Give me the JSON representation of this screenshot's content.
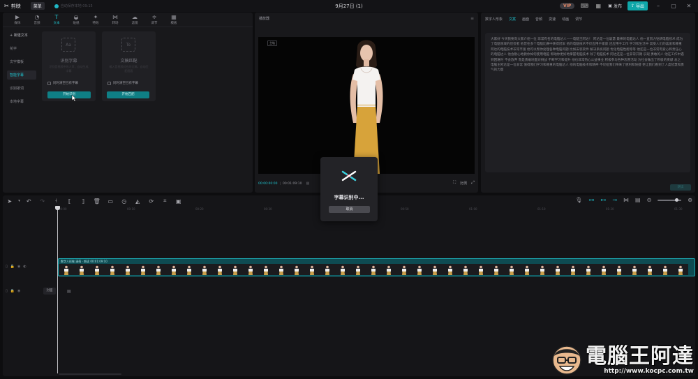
{
  "app": {
    "logo_text": "剪映",
    "menu_label": "菜单",
    "project_status": "自动保存本地 09:15",
    "window_title": "9月27日 (1)",
    "vip_label": "VIP",
    "publish_label": "发布",
    "export_label": "导出"
  },
  "tool_tabs": [
    {
      "label": "媒体",
      "icon": "media-icon"
    },
    {
      "label": "音频",
      "icon": "audio-icon"
    },
    {
      "label": "文本",
      "icon": "text-icon",
      "active": true
    },
    {
      "label": "贴纸",
      "icon": "sticker-icon"
    },
    {
      "label": "特效",
      "icon": "effects-icon"
    },
    {
      "label": "转场",
      "icon": "transition-icon"
    },
    {
      "label": "滤镜",
      "icon": "filter-icon"
    },
    {
      "label": "调节",
      "icon": "adjust-icon"
    },
    {
      "label": "模板",
      "icon": "template-icon"
    }
  ],
  "text_side": {
    "new_text": "+ 新建文本",
    "items": [
      "花字",
      "文字模板",
      "智能字幕",
      "识别歌词",
      "本地字幕"
    ],
    "active_index": 2
  },
  "cards": [
    {
      "title": "识别字幕",
      "desc": "识别音视频中的人声，自动生成字幕",
      "option": "同时清空已有字幕",
      "button": "开始识别",
      "icon_text": "Aa"
    },
    {
      "title": "文稿匹配",
      "desc": "输入音视频对应的文稿，自动匹配画面",
      "option": "同时清空已有字幕",
      "button": "开始匹配",
      "icon_text": "Te"
    }
  ],
  "player": {
    "title": "播放器",
    "tag": "主轨",
    "time_current": "00:00:00:00",
    "time_total": "00:01:09:10",
    "ratio_label": "比例"
  },
  "right_panel": {
    "tabs": [
      "数字人形象",
      "文案",
      "画面",
      "音频",
      "变速",
      "动画",
      "调节"
    ],
    "active_index": 1,
    "script": "大家好 今天我要向大家介绍一位 非常有名的电脑达人——电脑王阿达！ 阿达是一位聪慧 最棒的电脑达人 他一直努力钻研电脑技术 成为了电脑领域的佼佼者 他曾在多个电脑比赛中获得冠军 他的电脑技术不仅应用于家庭 还应用于工作 学习和生活中 其受人们的喜爱和尊重 阿达的电脑技术非常丰富 他可以帮你处理各种电脑问题 比如安装软件 解决系统问题 优化电脑性能等等 他还是一位非常有爱心和责任心的电脑达人 他会耐心地教你如何使用电脑 帮助你更好地掌握电脑技术 除了电脑技术 阿达还是一位非常开朗 乐观 勇敢的人 他在工作中遇到困难时 不会放弃 而是勇敢地面对挑战 不断学习和提升 他也非常热心公益事业 积极参与各种志愿活动 为社会做出了积极的贡献 总之 电脑王阿达是一位非常 值得我们学习和尊重的电脑达人 他的电脑技术和精神 不仅给我们带来了便利和快捷 更让我们看到了人类智慧和勇气的力量",
    "button": "朗读"
  },
  "timeline": {
    "ticks": [
      "00:00",
      "00:10",
      "00:20",
      "00:30",
      "00:40",
      "00:50",
      "01:00",
      "01:10",
      "01:20",
      "01:30"
    ],
    "clip_label": "数字人形象 清萌 · 朗读  00:01:09:10",
    "cover_label": "封面"
  },
  "modal": {
    "status": "字幕识别中...",
    "cancel": "取消"
  },
  "watermark": {
    "text": "電腦王阿達",
    "url": "http://www.kocpc.com.tw"
  },
  "colors": {
    "accent": "#1fc3ce",
    "export": "#0fa7a9",
    "clip": "#0e4b52"
  }
}
